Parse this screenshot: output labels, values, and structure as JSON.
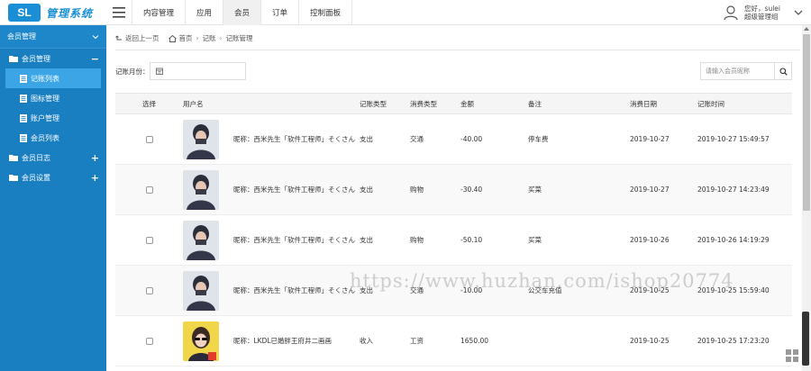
{
  "app": {
    "logo_badge": "SL",
    "logo_text": "管理系统",
    "brand_color": "#1a8fd6"
  },
  "topnav": {
    "tabs": [
      {
        "label": "内容管理"
      },
      {
        "label": "应用"
      },
      {
        "label": "会员",
        "active": true
      },
      {
        "label": "订单"
      },
      {
        "label": "控制面板"
      }
    ]
  },
  "user": {
    "greeting": "您好，sulei",
    "role": "超级管理组"
  },
  "sidebar": {
    "header": "会员管理",
    "groups": [
      {
        "label": "会员管理",
        "sign": "−",
        "items": [
          {
            "label": "记账列表",
            "active": true
          },
          {
            "label": "图标管理"
          },
          {
            "label": "账户管理"
          },
          {
            "label": "会员列表"
          }
        ]
      },
      {
        "label": "会员日志",
        "sign": "+"
      },
      {
        "label": "会员设置",
        "sign": "+"
      }
    ],
    "color": "#1a7fc1"
  },
  "breadcrumb": {
    "back": "返回上一页",
    "home": "首页",
    "level1": "记账",
    "level2": "记账管理"
  },
  "filter": {
    "month_label": "记账月份：",
    "search_placeholder": "请输入会员昵称"
  },
  "table": {
    "headers": {
      "select": "选择",
      "user": "用户名",
      "type": "记账类型",
      "consume": "消费类型",
      "amount": "金额",
      "note": "备注",
      "date": "消费日期",
      "time": "记账时间"
    },
    "rows": [
      {
        "nick": "昵称：西米先生「软件工程师」そくさん",
        "type": "支出",
        "consume": "交通",
        "amount": "-40.00",
        "note": "停车费",
        "date": "2019-10-27",
        "time": "2019-10-27 15:49:57"
      },
      {
        "nick": "昵称：西米先生「软件工程师」そくさん",
        "type": "支出",
        "consume": "购物",
        "amount": "-30.40",
        "note": "买菜",
        "date": "2019-10-27",
        "time": "2019-10-27 14:23:49"
      },
      {
        "nick": "昵称：西米先生「软件工程师」そくさん",
        "type": "支出",
        "consume": "购物",
        "amount": "-50.10",
        "note": "买菜",
        "date": "2019-10-26",
        "time": "2019-10-26 14:19:29"
      },
      {
        "nick": "昵称：西米先生「软件工程师」そくさん",
        "type": "支出",
        "consume": "交通",
        "amount": "-10.00",
        "note": "公交车充值",
        "date": "2019-10-25",
        "time": "2019-10-25 15:59:40"
      },
      {
        "nick": "昵称：LKDL已婚胖王府井二画画",
        "type": "收入",
        "consume": "工资",
        "amount": "1650.00",
        "note": "",
        "date": "2019-10-25",
        "time": "2019-10-25 17:23:20"
      }
    ]
  },
  "watermark": "https://www.huzhan.com/ishop20774"
}
